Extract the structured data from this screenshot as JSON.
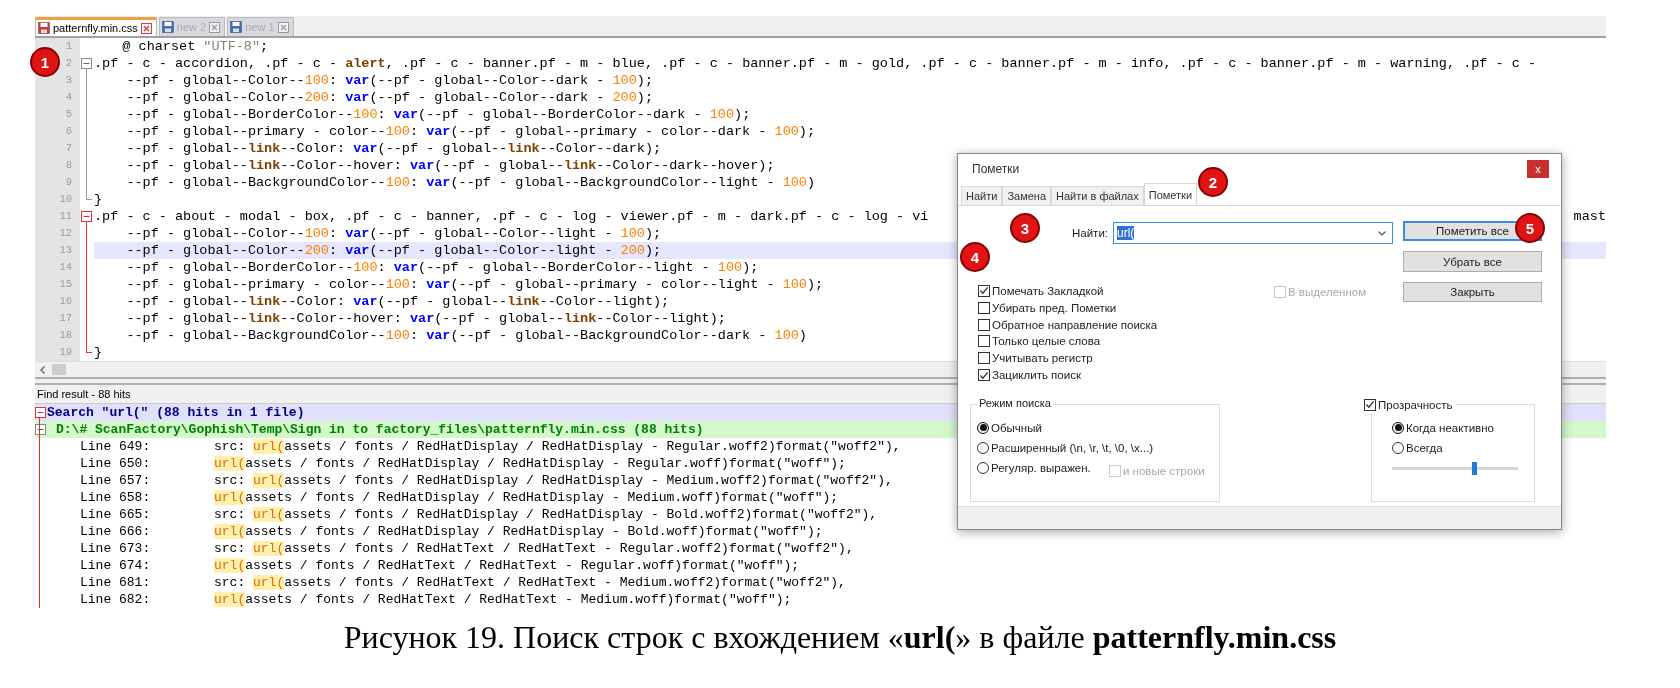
{
  "editor_tabs": [
    {
      "label": "patternfly.min.css",
      "selected": true,
      "modified": true
    },
    {
      "label": "new 2",
      "selected": false,
      "modified": false
    },
    {
      "label": "new 1",
      "selected": false,
      "modified": false
    }
  ],
  "code_lines": [
    {
      "number": "1",
      "kind": "at",
      "current": false,
      "segments": [
        {
          "text": "@ charset ",
          "kind": "plain"
        },
        {
          "text": "\"UTF-8\"",
          "kind": "string"
        },
        {
          "text": ";",
          "kind": "plain"
        }
      ]
    },
    {
      "number": "2",
      "kind": "rule",
      "current": false,
      "segments": [
        {
          "text": ".pf - c - accordion, .pf - c - ",
          "kind": "plain"
        },
        {
          "text": "alert",
          "kind": "word"
        },
        {
          "text": ", .pf - c - banner.pf - m - blue, .pf - c - banner.pf - m - gold, .pf - c - banner.pf - m - info, .pf - c - banner.pf - m - warning, .pf - c -",
          "kind": "plain"
        }
      ]
    },
    {
      "number": "3",
      "kind": "decl",
      "current": false,
      "segments": [
        {
          "text": "--pf - global--Color--",
          "kind": "plain"
        },
        {
          "text": "100",
          "kind": "number"
        },
        {
          "text": ": ",
          "kind": "plain"
        },
        {
          "text": "var",
          "kind": "keyword"
        },
        {
          "text": "(--pf - global--Color--dark - ",
          "kind": "plain"
        },
        {
          "text": "100",
          "kind": "number"
        },
        {
          "text": ");",
          "kind": "plain"
        }
      ]
    },
    {
      "number": "4",
      "kind": "decl",
      "current": false,
      "segments": [
        {
          "text": "--pf - global--Color--",
          "kind": "plain"
        },
        {
          "text": "200",
          "kind": "number"
        },
        {
          "text": ": ",
          "kind": "plain"
        },
        {
          "text": "var",
          "kind": "keyword"
        },
        {
          "text": "(--pf - global--Color--dark - ",
          "kind": "plain"
        },
        {
          "text": "200",
          "kind": "number"
        },
        {
          "text": ");",
          "kind": "plain"
        }
      ]
    },
    {
      "number": "5",
      "kind": "decl",
      "current": false,
      "segments": [
        {
          "text": "--pf - global--BorderColor--",
          "kind": "plain"
        },
        {
          "text": "100",
          "kind": "number"
        },
        {
          "text": ": ",
          "kind": "plain"
        },
        {
          "text": "var",
          "kind": "keyword"
        },
        {
          "text": "(--pf - global--BorderColor--dark - ",
          "kind": "plain"
        },
        {
          "text": "100",
          "kind": "number"
        },
        {
          "text": ");",
          "kind": "plain"
        }
      ]
    },
    {
      "number": "6",
      "kind": "decl",
      "current": false,
      "segments": [
        {
          "text": "--pf - global--primary - color--",
          "kind": "plain"
        },
        {
          "text": "100",
          "kind": "number"
        },
        {
          "text": ": ",
          "kind": "plain"
        },
        {
          "text": "var",
          "kind": "keyword"
        },
        {
          "text": "(--pf - global--primary - color--dark - ",
          "kind": "plain"
        },
        {
          "text": "100",
          "kind": "number"
        },
        {
          "text": ");",
          "kind": "plain"
        }
      ]
    },
    {
      "number": "7",
      "kind": "decl",
      "current": false,
      "segments": [
        {
          "text": "--pf - global--",
          "kind": "plain"
        },
        {
          "text": "link",
          "kind": "word"
        },
        {
          "text": "--Color: ",
          "kind": "plain"
        },
        {
          "text": "var",
          "kind": "keyword"
        },
        {
          "text": "(--pf - global--",
          "kind": "plain"
        },
        {
          "text": "link",
          "kind": "word"
        },
        {
          "text": "--Color--dark);",
          "kind": "plain"
        }
      ]
    },
    {
      "number": "8",
      "kind": "decl",
      "current": false,
      "segments": [
        {
          "text": "--pf - global--",
          "kind": "plain"
        },
        {
          "text": "link",
          "kind": "word"
        },
        {
          "text": "--Color--hover: ",
          "kind": "plain"
        },
        {
          "text": "var",
          "kind": "keyword"
        },
        {
          "text": "(--pf - global--",
          "kind": "plain"
        },
        {
          "text": "link",
          "kind": "word"
        },
        {
          "text": "--Color--dark--hover);",
          "kind": "plain"
        }
      ]
    },
    {
      "number": "9",
      "kind": "decl",
      "current": false,
      "segments": [
        {
          "text": "--pf - global--BackgroundColor--",
          "kind": "plain"
        },
        {
          "text": "100",
          "kind": "number"
        },
        {
          "text": ": ",
          "kind": "plain"
        },
        {
          "text": "var",
          "kind": "keyword"
        },
        {
          "text": "(--pf - global--BackgroundColor--light - ",
          "kind": "plain"
        },
        {
          "text": "100",
          "kind": "number"
        },
        {
          "text": ")",
          "kind": "plain"
        }
      ]
    },
    {
      "number": "10",
      "kind": "close",
      "current": false,
      "segments": [
        {
          "text": "}",
          "kind": "plain"
        }
      ]
    },
    {
      "number": "11",
      "kind": "rule",
      "current": false,
      "tail": "mast",
      "segments": [
        {
          "text": ".pf - c - about - modal - box, .pf - c - banner, .pf - c - log - viewer.pf - m - dark.pf - c - log - vi",
          "kind": "plain"
        }
      ]
    },
    {
      "number": "12",
      "kind": "decl",
      "current": false,
      "segments": [
        {
          "text": "--pf - global--Color--",
          "kind": "plain"
        },
        {
          "text": "100",
          "kind": "number"
        },
        {
          "text": ": ",
          "kind": "plain"
        },
        {
          "text": "var",
          "kind": "keyword"
        },
        {
          "text": "(--pf - global--Color--light - ",
          "kind": "plain"
        },
        {
          "text": "100",
          "kind": "number"
        },
        {
          "text": ");",
          "kind": "plain"
        }
      ]
    },
    {
      "number": "13",
      "kind": "decl",
      "current": true,
      "segments": [
        {
          "text": "--pf - global--Color--",
          "kind": "plain"
        },
        {
          "text": "200",
          "kind": "number"
        },
        {
          "text": ": ",
          "kind": "plain"
        },
        {
          "text": "var",
          "kind": "keyword"
        },
        {
          "text": "(--pf - global--Color--light - ",
          "kind": "plain"
        },
        {
          "text": "200",
          "kind": "number"
        },
        {
          "text": ");",
          "kind": "plain"
        }
      ]
    },
    {
      "number": "14",
      "kind": "decl",
      "current": false,
      "segments": [
        {
          "text": "--pf - global--BorderColor--",
          "kind": "plain"
        },
        {
          "text": "100",
          "kind": "number"
        },
        {
          "text": ": ",
          "kind": "plain"
        },
        {
          "text": "var",
          "kind": "keyword"
        },
        {
          "text": "(--pf - global--BorderColor--light - ",
          "kind": "plain"
        },
        {
          "text": "100",
          "kind": "number"
        },
        {
          "text": ");",
          "kind": "plain"
        }
      ]
    },
    {
      "number": "15",
      "kind": "decl",
      "current": false,
      "segments": [
        {
          "text": "--pf - global--primary - color--",
          "kind": "plain"
        },
        {
          "text": "100",
          "kind": "number"
        },
        {
          "text": ": ",
          "kind": "plain"
        },
        {
          "text": "var",
          "kind": "keyword"
        },
        {
          "text": "(--pf - global--primary - color--light - ",
          "kind": "plain"
        },
        {
          "text": "100",
          "kind": "number"
        },
        {
          "text": ");",
          "kind": "plain"
        }
      ]
    },
    {
      "number": "16",
      "kind": "decl",
      "current": false,
      "segments": [
        {
          "text": "--pf - global--",
          "kind": "plain"
        },
        {
          "text": "link",
          "kind": "word"
        },
        {
          "text": "--Color: ",
          "kind": "plain"
        },
        {
          "text": "var",
          "kind": "keyword"
        },
        {
          "text": "(--pf - global--",
          "kind": "plain"
        },
        {
          "text": "link",
          "kind": "word"
        },
        {
          "text": "--Color--light);",
          "kind": "plain"
        }
      ]
    },
    {
      "number": "17",
      "kind": "decl",
      "current": false,
      "segments": [
        {
          "text": "--pf - global--",
          "kind": "plain"
        },
        {
          "text": "link",
          "kind": "word"
        },
        {
          "text": "--Color--hover: ",
          "kind": "plain"
        },
        {
          "text": "var",
          "kind": "keyword"
        },
        {
          "text": "(--pf - global--",
          "kind": "plain"
        },
        {
          "text": "link",
          "kind": "word"
        },
        {
          "text": "--Color--light);",
          "kind": "plain"
        }
      ]
    },
    {
      "number": "18",
      "kind": "decl",
      "current": false,
      "segments": [
        {
          "text": "--pf - global--BackgroundColor--",
          "kind": "plain"
        },
        {
          "text": "100",
          "kind": "number"
        },
        {
          "text": ": ",
          "kind": "plain"
        },
        {
          "text": "var",
          "kind": "keyword"
        },
        {
          "text": "(--pf - global--BackgroundColor--dark - ",
          "kind": "plain"
        },
        {
          "text": "100",
          "kind": "number"
        },
        {
          "text": ")",
          "kind": "plain"
        }
      ]
    },
    {
      "number": "19",
      "kind": "close",
      "current": false,
      "segments": [
        {
          "text": "}",
          "kind": "plain"
        }
      ]
    }
  ],
  "find_results": {
    "title": "Find result - 88 hits",
    "search": "Search \"url(\" (88 hits in 1 file)",
    "file": "D:\\# ScanFactory\\Gophish\\Temp\\Sign in to factory_files\\patternfly.min.css (88 hits)",
    "rows": [
      {
        "label": "Line 649:",
        "prefix": "src: ",
        "match": "url(",
        "rest": "assets / fonts / RedHatDisplay / RedHatDisplay - Regular.woff2)format(\"woff2\"),"
      },
      {
        "label": "Line 650:",
        "match": "url(",
        "rest": "assets / fonts / RedHatDisplay / RedHatDisplay - Regular.woff)format(\"woff\");"
      },
      {
        "label": "Line 657:",
        "prefix": "src: ",
        "match": "url(",
        "rest": "assets / fonts / RedHatDisplay / RedHatDisplay - Medium.woff2)format(\"woff2\"),"
      },
      {
        "label": "Line 658:",
        "match": "url(",
        "rest": "assets / fonts / RedHatDisplay / RedHatDisplay - Medium.woff)format(\"woff\");"
      },
      {
        "label": "Line 665:",
        "prefix": "src: ",
        "match": "url(",
        "rest": "assets / fonts / RedHatDisplay / RedHatDisplay - Bold.woff2)format(\"woff2\"),"
      },
      {
        "label": "Line 666:",
        "match": "url(",
        "rest": "assets / fonts / RedHatDisplay / RedHatDisplay - Bold.woff)format(\"woff\");"
      },
      {
        "label": "Line 673:",
        "prefix": "src: ",
        "match": "url(",
        "rest": "assets / fonts / RedHatText / RedHatText - Regular.woff2)format(\"woff2\"),"
      },
      {
        "label": "Line 674:",
        "match": "url(",
        "rest": "assets / fonts / RedHatText / RedHatText - Regular.woff)format(\"woff\");"
      },
      {
        "label": "Line 681:",
        "prefix": "src: ",
        "match": "url(",
        "rest": "assets / fonts / RedHatText / RedHatText - Medium.woff2)format(\"woff2\"),"
      },
      {
        "label": "Line 682:",
        "match": "url(",
        "rest": "assets / fonts / RedHatText / RedHatText - Medium.woff)format(\"woff\");"
      }
    ]
  },
  "dialog": {
    "title": "Пометки",
    "close": "x",
    "tabs": [
      {
        "label": "Найти",
        "selected": false
      },
      {
        "label": "Замена",
        "selected": false
      },
      {
        "label": "Найти в файлах",
        "selected": false
      },
      {
        "label": "Пометки",
        "selected": true
      }
    ],
    "find_label": "Найти:",
    "find_value": "url(",
    "value_selected": true,
    "buttons": [
      {
        "label": "Пометить все",
        "default": true
      },
      {
        "label": "Убрать все",
        "default": false
      },
      {
        "label": "Закрыть",
        "default": false
      }
    ],
    "options": [
      {
        "label": "Помечать Закладкой",
        "checked": true
      },
      {
        "label": "Убирать пред. Пометки",
        "checked": false
      },
      {
        "label": "Обратное направление поиска",
        "checked": false
      },
      {
        "label": "Только целые слова",
        "checked": false
      },
      {
        "label": "Учитывать регистр",
        "checked": false
      },
      {
        "label": "Зациклить поиск",
        "checked": true
      }
    ],
    "in_selection": {
      "label": "В выделенном",
      "checked": false,
      "disabled": true
    },
    "search_mode": {
      "title": "Режим поиска",
      "modes": [
        {
          "label": "Обычный",
          "selected": true
        },
        {
          "label": "Расширенный (\\n, \\r, \\t, \\0, \\x...)",
          "selected": false
        },
        {
          "label": "Регуляр. выражен.",
          "selected": false
        }
      ],
      "newlines": {
        "label": "и новые строки",
        "checked": false,
        "disabled": true
      }
    },
    "transparency": {
      "label": "Прозрачность",
      "checked": true,
      "modes": [
        {
          "label": "Когда неактивно",
          "selected": true
        },
        {
          "label": "Всегда",
          "selected": false
        }
      ],
      "level": 0.65
    }
  },
  "callouts": [
    {
      "label": "1"
    },
    {
      "label": "2"
    },
    {
      "label": "3"
    },
    {
      "label": "4"
    },
    {
      "label": "5"
    }
  ],
  "caption": "Рисунок 19. Поиск строк с вхождением «**url(**» в файле **patternfly.min.css**"
}
